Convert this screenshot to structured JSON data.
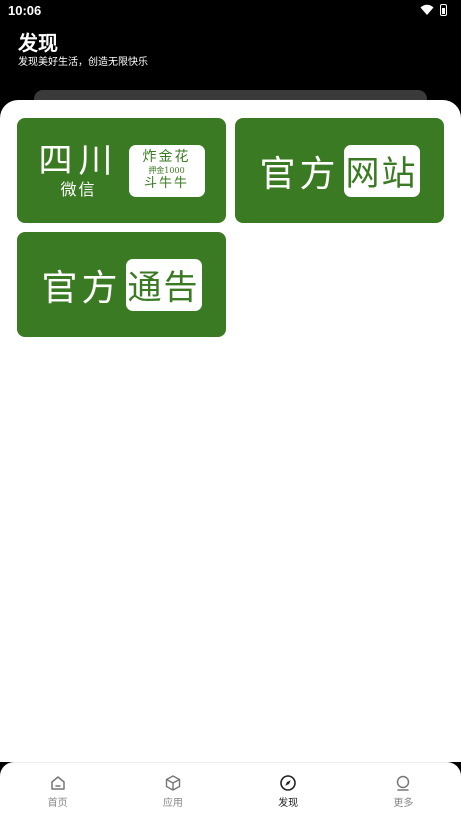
{
  "status_bar": {
    "time": "10:06",
    "icons": [
      "wifi-icon",
      "battery-icon"
    ]
  },
  "header": {
    "title": "发现",
    "subtitle": "发现美好生活，创造无限快乐"
  },
  "tiles": [
    {
      "name": "四川微信",
      "left_big": "四川",
      "left_small": "微信",
      "box_line1": "炸金花",
      "box_line2": "押金1000",
      "box_line3": "斗牛牛"
    },
    {
      "name": "官方网站",
      "left": "官方",
      "box": "网站"
    },
    {
      "name": "官方通告",
      "left": "官方",
      "box": "通告"
    }
  ],
  "tabbar": {
    "items": [
      {
        "label": "首页",
        "icon": "home-icon"
      },
      {
        "label": "应用",
        "icon": "cube-icon"
      },
      {
        "label": "发现",
        "icon": "compass-icon",
        "active": true
      },
      {
        "label": "更多",
        "icon": "more-icon"
      }
    ]
  },
  "colors": {
    "tile_bg": "#3a7a22",
    "header_bg": "#000000",
    "active_tab": "#222222",
    "inactive_tab": "#888888"
  }
}
